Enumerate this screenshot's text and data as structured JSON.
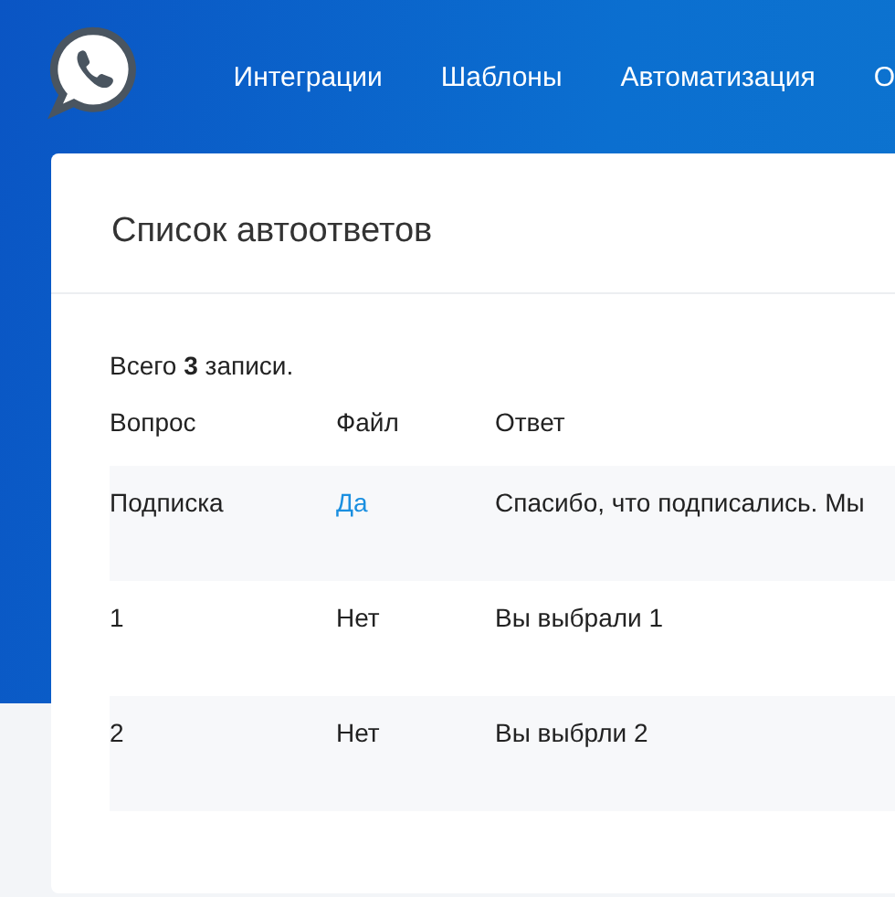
{
  "nav": {
    "items": [
      "Интеграции",
      "Шаблоны",
      "Автоматизация",
      "О"
    ]
  },
  "card": {
    "title": "Список автоответов",
    "summary": "Всего **3** записи.",
    "table": {
      "columns": [
        "Вопрос",
        "Файл",
        "Ответ"
      ],
      "rows": [
        {
          "question": "Подписка",
          "file": "Да",
          "file_link": true,
          "answer": "Спасибо, что подписались. Мы"
        },
        {
          "question": "1",
          "file": "Нет",
          "file_link": false,
          "answer": "Вы выбрали 1"
        },
        {
          "question": "2",
          "file": "Нет",
          "file_link": false,
          "answer": "Вы выбрли 2"
        }
      ]
    }
  }
}
